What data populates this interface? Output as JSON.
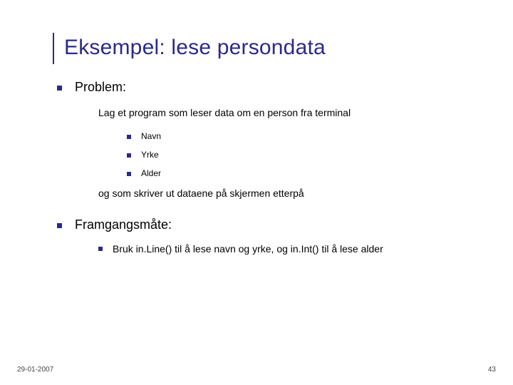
{
  "title": "Eksempel: lese persondata",
  "sections": [
    {
      "heading": "Problem:",
      "intro": "Lag et program som leser data om en person fra terminal",
      "items": [
        "Navn",
        "Yrke",
        "Alder"
      ],
      "outro": "og som skriver ut dataene på skjermen etterpå"
    },
    {
      "heading": "Framgangsmåte:",
      "items": [
        "Bruk in.Line() til å lese navn og yrke, og in.Int() til å lese alder"
      ]
    }
  ],
  "footer": {
    "date": "29-01-2007",
    "page": "43"
  }
}
